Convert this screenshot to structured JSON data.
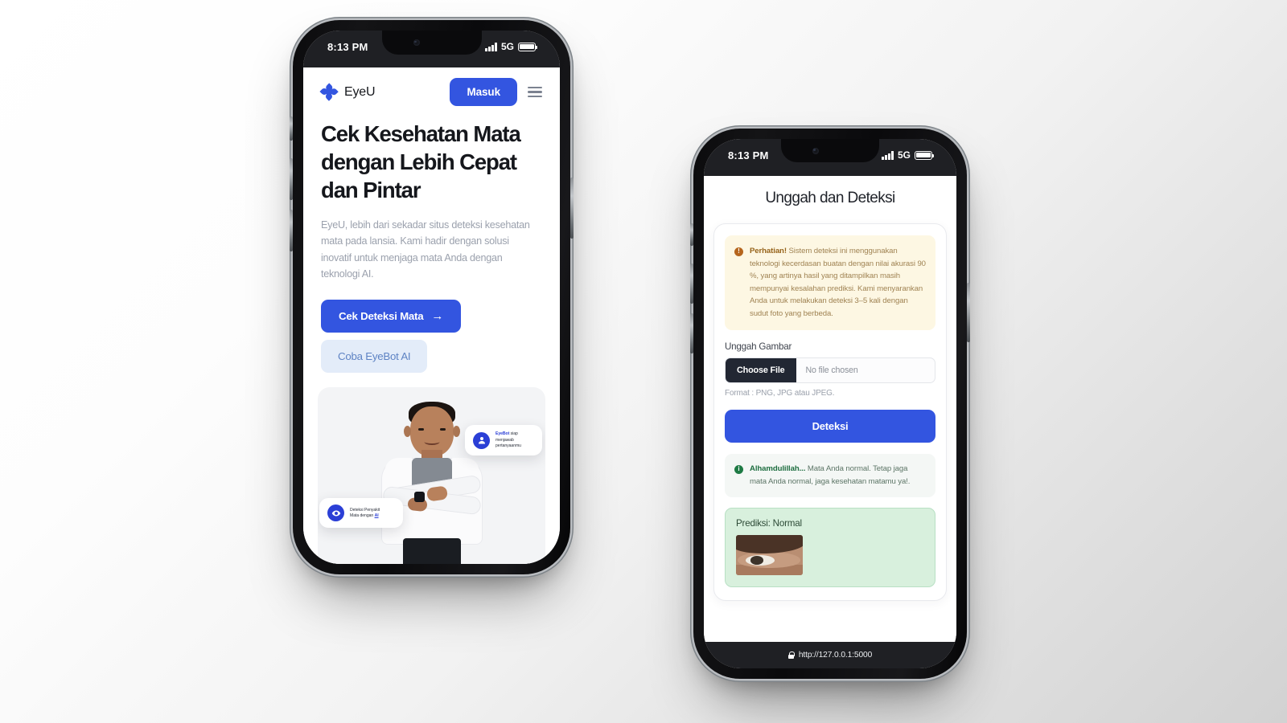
{
  "background": {
    "from": "#ffffff",
    "to": "#d2d2d2"
  },
  "accent": {
    "blue": "#3355e0",
    "dark": "#222733",
    "warn_bg": "#fdf7e3",
    "warn_fg": "#96631a",
    "ok_bg": "#d8f0dd",
    "ok_fg": "#1e6e40"
  },
  "phone1": {
    "status": {
      "time": "8:13 PM",
      "network": "5G",
      "signal_icon": "signal-bars-icon",
      "battery_icon": "battery-icon"
    },
    "navbar": {
      "logo_icon": "eyeu-flower-logo-icon",
      "brand": "EyeU",
      "login_label": "Masuk",
      "menu_icon": "hamburger-menu-icon"
    },
    "hero": {
      "heading": "Cek Kesehatan Mata dengan Lebih Cepat dan Pintar",
      "paragraph": "EyeU, lebih dari sekadar situs deteksi kesehatan mata pada lansia. Kami hadir dengan solusi inovatif untuk menjaga mata Anda dengan teknologi AI.",
      "cta_primary": "Cek Deteksi Mata",
      "cta_primary_arrow": "→",
      "cta_secondary": "Coba EyeBot AI"
    },
    "badges": [
      {
        "id": "badge-chat",
        "icon": "chat-bot-avatar-icon",
        "line1": "EyeBot",
        "line1_rest": " siap",
        "line2": "menjawab",
        "line3": "pertanyaanmu"
      },
      {
        "id": "badge-detect",
        "icon": "eye-scan-icon",
        "line1": "Deteksi Penyakit",
        "line2": "Mata dengan ",
        "line2_hl": "AI"
      }
    ],
    "hero_image_alt": "doctor-photo"
  },
  "phone2": {
    "status": {
      "time": "8:13 PM",
      "network": "5G",
      "signal_icon": "signal-bars-icon",
      "battery_icon": "battery-icon"
    },
    "page_title": "Unggah dan Deteksi",
    "alert_warning": {
      "icon": "warning-circle-icon",
      "bold": "Perhatian!",
      "text": " Sistem deteksi ini menggunakan teknologi kecerdasan buatan dengan nilai akurasi 90 %, yang artinya hasil yang ditampilkan masih mempunyai kesalahan prediksi. Kami menyarankan Anda untuk melakukan deteksi 3–5 kali dengan sudut foto yang berbeda."
    },
    "upload": {
      "label": "Unggah Gambar",
      "choose_file_label": "Choose File",
      "file_status": "No file chosen",
      "format_hint": "Format : PNG, JPG atau JPEG."
    },
    "detect_button": "Deteksi",
    "alert_success": {
      "icon": "info-circle-icon",
      "bold": "Alhamdulillah...",
      "text": " Mata Anda normal. Tetap jaga mata Anda normal, jaga kesehatan matamu ya!."
    },
    "prediction": {
      "label": "Prediksi: Normal",
      "image_alt": "eye-thumbnail"
    },
    "urlbar": {
      "lock_icon": "lock-icon",
      "url": "http://127.0.0.1:5000"
    }
  }
}
